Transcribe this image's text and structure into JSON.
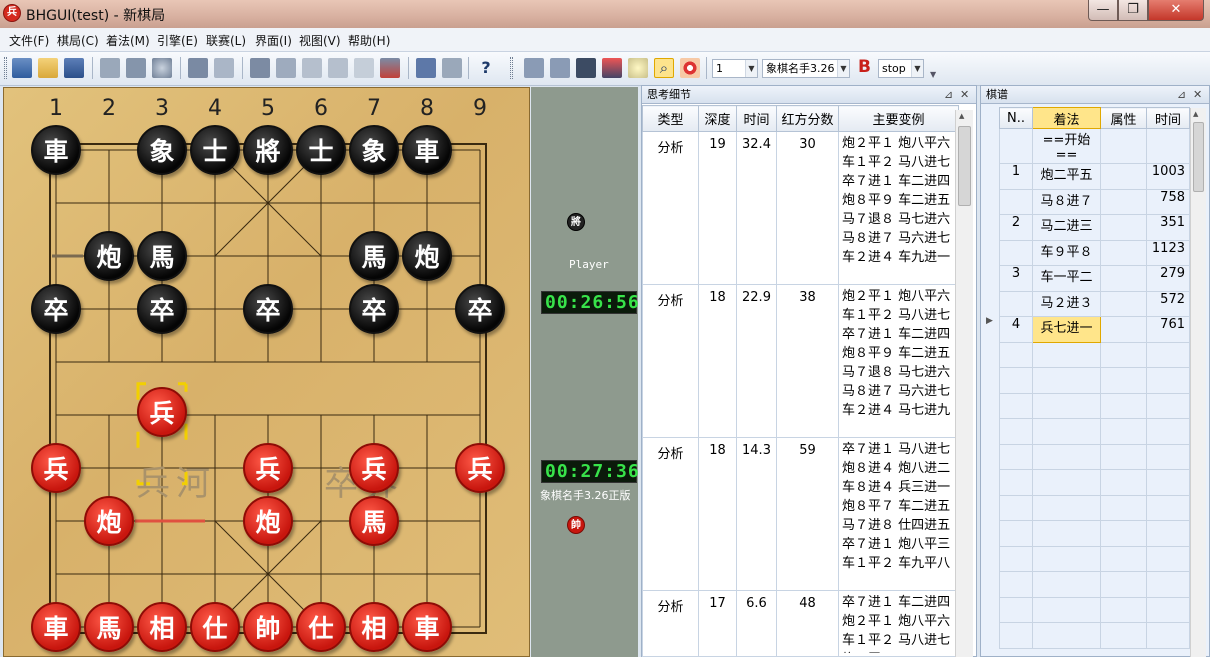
{
  "window": {
    "title": "BHGUI(test) - 新棋局",
    "app_icon": "兵",
    "minimize_icon": "—",
    "maximize_icon": "❐",
    "close_icon": "✕"
  },
  "menu": [
    "文件(F)",
    "棋局(C)",
    "着法(M)",
    "引擎(E)",
    "联赛(L)",
    "界面(I)",
    "视图(V)",
    "帮助(H)"
  ],
  "toolbar": {
    "depth_value": "1",
    "engine_name": "象棋名手3.26",
    "stop_label": "stop",
    "bold_label": "B",
    "help_label": "?"
  },
  "board": {
    "column_numbers": [
      "1",
      "2",
      "3",
      "4",
      "5",
      "6",
      "7",
      "8",
      "9"
    ],
    "river_left": "兵河",
    "river_right": "卒界",
    "pieces": [
      {
        "side": "black",
        "char": "車",
        "col": 0,
        "row": 0
      },
      {
        "side": "black",
        "char": "象",
        "col": 2,
        "row": 0
      },
      {
        "side": "black",
        "char": "士",
        "col": 3,
        "row": 0
      },
      {
        "side": "black",
        "char": "將",
        "col": 4,
        "row": 0
      },
      {
        "side": "black",
        "char": "士",
        "col": 5,
        "row": 0
      },
      {
        "side": "black",
        "char": "象",
        "col": 6,
        "row": 0
      },
      {
        "side": "black",
        "char": "車",
        "col": 7,
        "row": 0
      },
      {
        "side": "black",
        "char": "炮",
        "col": 1,
        "row": 2
      },
      {
        "side": "black",
        "char": "馬",
        "col": 2,
        "row": 2
      },
      {
        "side": "black",
        "char": "馬",
        "col": 6,
        "row": 2
      },
      {
        "side": "black",
        "char": "炮",
        "col": 7,
        "row": 2
      },
      {
        "side": "black",
        "char": "卒",
        "col": 0,
        "row": 3
      },
      {
        "side": "black",
        "char": "卒",
        "col": 2,
        "row": 3
      },
      {
        "side": "black",
        "char": "卒",
        "col": 4,
        "row": 3
      },
      {
        "side": "black",
        "char": "卒",
        "col": 6,
        "row": 3
      },
      {
        "side": "black",
        "char": "卒",
        "col": 8,
        "row": 3
      },
      {
        "side": "red",
        "char": "兵",
        "col": 2,
        "row": 5
      },
      {
        "side": "red",
        "char": "兵",
        "col": 0,
        "row": 6
      },
      {
        "side": "red",
        "char": "兵",
        "col": 4,
        "row": 6
      },
      {
        "side": "red",
        "char": "兵",
        "col": 6,
        "row": 6
      },
      {
        "side": "red",
        "char": "兵",
        "col": 8,
        "row": 6
      },
      {
        "side": "red",
        "char": "炮",
        "col": 1,
        "row": 7
      },
      {
        "side": "red",
        "char": "炮",
        "col": 4,
        "row": 7
      },
      {
        "side": "red",
        "char": "馬",
        "col": 6,
        "row": 7
      },
      {
        "side": "red",
        "char": "車",
        "col": 0,
        "row": 9
      },
      {
        "side": "red",
        "char": "馬",
        "col": 1,
        "row": 9
      },
      {
        "side": "red",
        "char": "相",
        "col": 2,
        "row": 9
      },
      {
        "side": "red",
        "char": "仕",
        "col": 3,
        "row": 9
      },
      {
        "side": "red",
        "char": "帥",
        "col": 4,
        "row": 9
      },
      {
        "side": "red",
        "char": "仕",
        "col": 5,
        "row": 9
      },
      {
        "side": "red",
        "char": "相",
        "col": 6,
        "row": 9
      },
      {
        "side": "red",
        "char": "車",
        "col": 7,
        "row": 9
      }
    ]
  },
  "clock": {
    "black_piece": "將",
    "black_name": "Player",
    "black_time": "00:26:56",
    "red_time": "00:27:36",
    "red_name": "象棋名手3.26正版",
    "red_piece": "帥"
  },
  "think_panel": {
    "title": "思考细节",
    "pin": "⊿",
    "close": "✕",
    "columns": [
      "类型",
      "深度",
      "时间",
      "红方分数",
      "主要变例"
    ],
    "rows": [
      {
        "type": "分析",
        "depth": "19",
        "time": "32.4",
        "score": "30",
        "pv": "炮２平１ 炮八平六 车１平２ 马八进七 卒７进１ 车二进四 炮８平９ 车二进五 马７退８ 马七进六 马８进７ 马六进七 车２进４ 车九进一"
      },
      {
        "type": "分析",
        "depth": "18",
        "time": "22.9",
        "score": "38",
        "pv": "炮２平１ 炮八平六 车１平２ 马八进七 卒７进１ 车二进四 炮８平９ 车二进五 马７退８ 马七进六 马８进７ 马六进七 车２进４ 马七进九"
      },
      {
        "type": "分析",
        "depth": "18",
        "time": "14.3",
        "score": "59",
        "pv": "卒７进１ 马八进七 炮８进４ 炮八进二 车８进４ 兵三进一 炮８平７ 车二进五 马７进８ 仕四进五 卒７进１ 炮八平三 车１平２ 车九平八"
      },
      {
        "type": "分析",
        "depth": "17",
        "time": "6.6",
        "score": "48",
        "pv": "卒７进１ 车二进四 炮２平１ 炮八平六 车１平２ 马八进七 炮８平９"
      }
    ]
  },
  "record_panel": {
    "title": "棋谱",
    "pin": "⊿",
    "close": "✕",
    "columns": [
      "N..",
      "着法",
      "属性",
      "时间"
    ],
    "rows": [
      {
        "no": "",
        "move": "==开始==",
        "attr": "",
        "time": ""
      },
      {
        "no": "1",
        "move": "炮二平五",
        "attr": "",
        "time": "1003"
      },
      {
        "no": "",
        "move": "马８进７",
        "attr": "",
        "time": "758"
      },
      {
        "no": "2",
        "move": "马二进三",
        "attr": "",
        "time": "351"
      },
      {
        "no": "",
        "move": "车９平８",
        "attr": "",
        "time": "1123"
      },
      {
        "no": "3",
        "move": "车一平二",
        "attr": "",
        "time": "279"
      },
      {
        "no": "",
        "move": "马２进３",
        "attr": "",
        "time": "572"
      },
      {
        "no": "4",
        "move": "兵七进一",
        "attr": "",
        "time": "761"
      }
    ],
    "current_marker": "▶"
  }
}
